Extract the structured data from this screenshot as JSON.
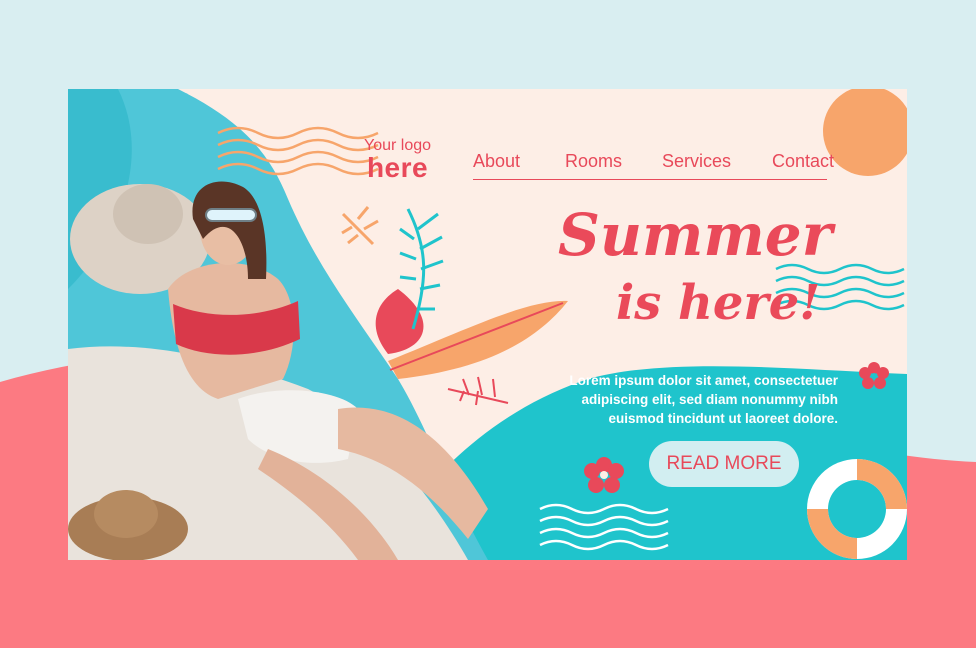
{
  "logo": {
    "line1": "Your logo",
    "line2": "here"
  },
  "nav": [
    {
      "label": "About"
    },
    {
      "label": "Rooms"
    },
    {
      "label": "Services"
    },
    {
      "label": "Contact"
    }
  ],
  "hero": {
    "title_line1": "Summer",
    "title_line2": "is here!",
    "body": "Lorem ipsum dolor sit amet, consectetuer adipiscing elit, sed diam nonummy nibh euismod tincidunt ut laoreet dolore.",
    "cta_label": "READ MORE"
  },
  "colors": {
    "page_bg": "#d9eef1",
    "coral": "#fc7a82",
    "card_bg": "#fdeee6",
    "accent_red": "#e8495a",
    "teal": "#1fc4cc",
    "peach": "#f7a56b",
    "button_bg": "#d2eef1"
  },
  "icons": [
    "flower-icon",
    "leaf-icon",
    "life-ring-icon",
    "wave-lines-icon",
    "sun-circle-icon"
  ]
}
